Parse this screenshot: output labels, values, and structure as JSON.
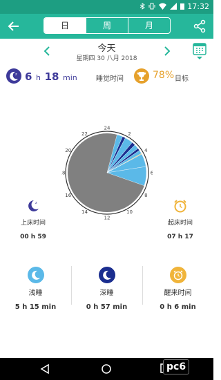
{
  "status": {
    "time": "17:32"
  },
  "tabs": [
    {
      "label": "日",
      "active": true
    },
    {
      "label": "周",
      "active": false
    },
    {
      "label": "月",
      "active": false
    }
  ],
  "date": {
    "title": "今天",
    "subtitle": "星期四 30 八月 2018"
  },
  "summary": {
    "hours": "6",
    "hour_unit": "h",
    "minutes": "18",
    "minute_unit": "min",
    "sleep_label": "睡觉时间",
    "goal_percent": "78%",
    "goal_label": "目标"
  },
  "clock": {
    "hour_labels": [
      "24",
      "2",
      "4",
      "6",
      "8",
      "10",
      "12",
      "14",
      "16",
      "18",
      "20",
      "22"
    ]
  },
  "bedtime": {
    "label": "上床时间",
    "value": "00 h 59"
  },
  "wake": {
    "label": "起床时间",
    "value": "07 h 17"
  },
  "stats": [
    {
      "name": "浅睡",
      "value": "5 h 15 min"
    },
    {
      "name": "深睡",
      "value": "0 h 57 min"
    },
    {
      "name": "醒来时间",
      "value": "0 h 6 min"
    }
  ],
  "watermark": "pc6",
  "colors": {
    "header": "#26b79b",
    "light_sleep": "#5bb9e8",
    "deep_sleep": "#1b2e8f",
    "awake": "#f0b43a",
    "remaining": "#808080",
    "goal": "#e6a12c"
  },
  "icons": {
    "back": "arrow-left-icon",
    "share": "share-icon",
    "calendar": "calendar-icon",
    "moon": "moon-icon",
    "trophy": "trophy-icon",
    "alarm": "alarm-clock-icon"
  }
}
